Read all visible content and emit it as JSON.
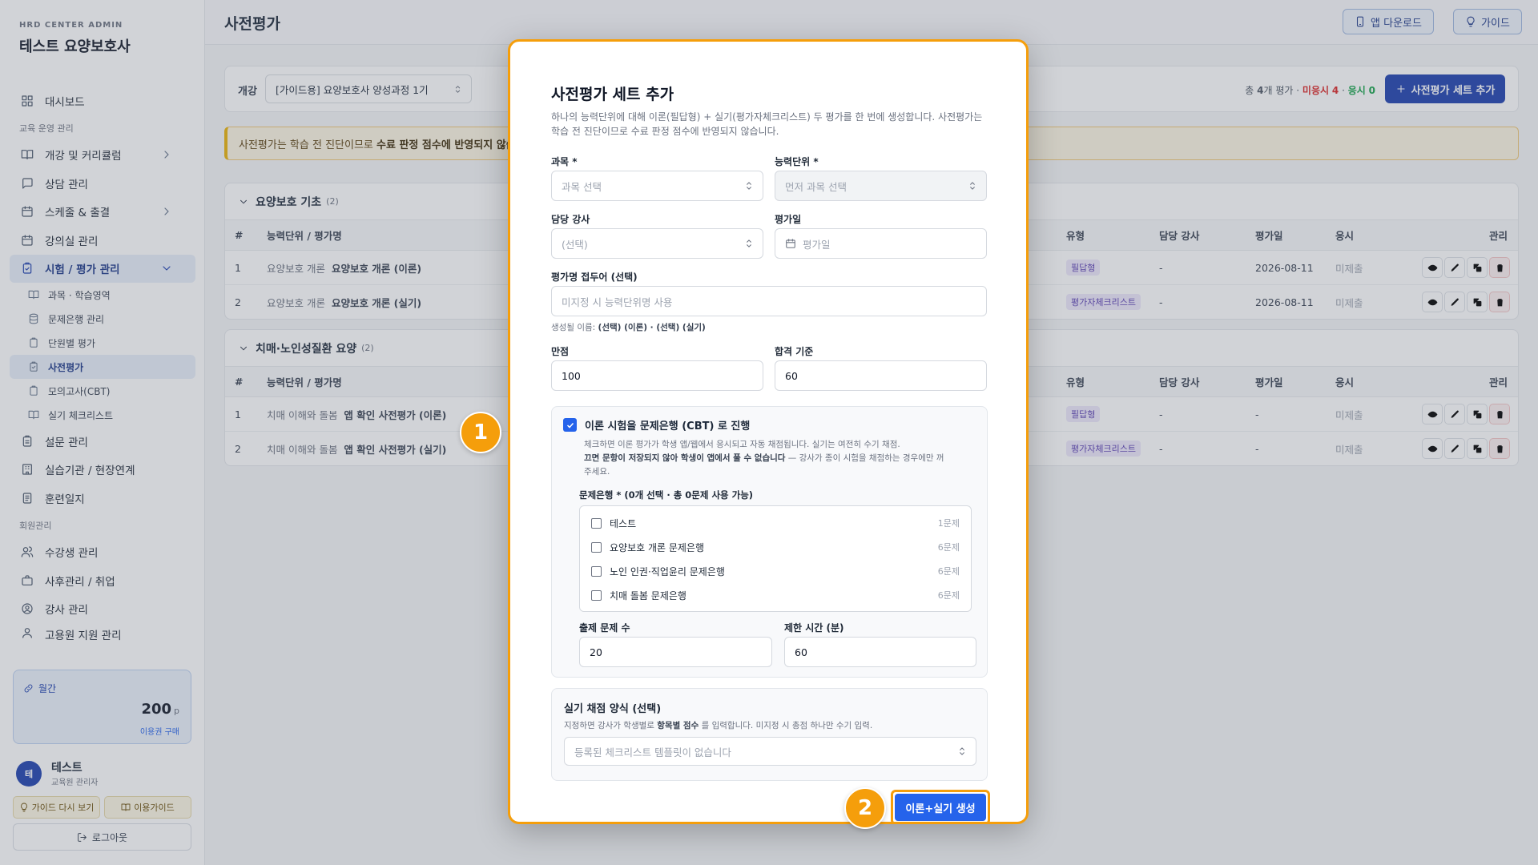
{
  "sidebar": {
    "brand_small": "HRD CENTER ADMIN",
    "brand": "테스트 요양보호사",
    "dashboard": "대시보드",
    "sec_edu": "교육 운영 관리",
    "items": [
      "개강 및 커리큘럼",
      "상담 관리",
      "스케줄 & 출결",
      "강의실 관리",
      "시험 / 평가 관리"
    ],
    "subs": [
      "과목 · 학습영역",
      "문제은행 관리",
      "단원별 평가",
      "사전평가",
      "모의고사(CBT)",
      "실기 체크리스트"
    ],
    "items2": [
      "설문 관리",
      "실습기관 / 현장연계",
      "훈련일지"
    ],
    "sec_member": "회원관리",
    "items3": [
      "수강생 관리",
      "사후관리 / 취업",
      "강사 관리",
      "고용원 지원 관리"
    ],
    "credit": {
      "label": "월간",
      "value": "200",
      "unit": "p",
      "buy": "이용권 구매"
    },
    "user": {
      "avatar": "테",
      "name": "테스트",
      "role": "교육원 관리자"
    },
    "guide_again": "가이드 다시 보기",
    "usage_guide": "이용가이드",
    "logout": "로그아웃"
  },
  "topbar": {
    "title": "사전평가",
    "app_download": "앱 다운로드",
    "guide": "가이드"
  },
  "filter": {
    "label": "개강",
    "course": "[가이드용] 요양보호사 양성과정 1기",
    "stats_pre": "총",
    "total": "4",
    "stats_mid": "개 평가 ·",
    "pending_label": "미응시",
    "pending": "4",
    "sep": "·",
    "done_label": "응시",
    "done": "0",
    "add_button": "사전평가 세트 추가"
  },
  "notice": {
    "text": "사전평가는 학습 전 진단이므로",
    "bold": "수료 판정 점수에 반영되지 않습"
  },
  "columns": {
    "num": "#",
    "name": "능력단위 / 평가명",
    "type": "유형",
    "teacher": "담당 강사",
    "date": "평가일",
    "status": "응시",
    "manage": "관리"
  },
  "groups": [
    {
      "title": "요양보호 기초",
      "count": "(2)",
      "rows": [
        {
          "num": "1",
          "unit": "요양보호 개론",
          "name": "요양보호 개론 (이론)",
          "type": "필답형",
          "teacher": "-",
          "date": "2026-08-11",
          "status": "미제출"
        },
        {
          "num": "2",
          "unit": "요양보호 개론",
          "name": "요양보호 개론 (실기)",
          "type": "평가자체크리스트",
          "teacher": "-",
          "date": "2026-08-11",
          "status": "미제출"
        }
      ]
    },
    {
      "title": "치매·노인성질환 요양",
      "count": "(2)",
      "rows": [
        {
          "num": "1",
          "unit": "치매 이해와 돌봄",
          "name": "앱 확인 사전평가 (이론)",
          "type": "필답형",
          "teacher": "-",
          "date": "-",
          "status": "미제출"
        },
        {
          "num": "2",
          "unit": "치매 이해와 돌봄",
          "name": "앱 확인 사전평가 (실기)",
          "type": "평가자체크리스트",
          "teacher": "-",
          "date": "-",
          "status": "미제출"
        }
      ]
    }
  ],
  "modal": {
    "title": "사전평가 세트 추가",
    "desc": "하나의 능력단위에 대해 이론(필답형) + 실기(평가자체크리스트) 두 평가를 한 번에 생성합니다. 사전평가는 학습 전 진단이므로 수료 판정 점수에 반영되지 않습니다.",
    "subject_label": "과목 *",
    "subject_ph": "과목 선택",
    "unit_label": "능력단위 *",
    "unit_ph": "먼저 과목 선택",
    "teacher_label": "담당 강사",
    "teacher_ph": "(선택)",
    "date_label": "평가일",
    "date_ph": "평가일",
    "prefix_label": "평가명 접두어 (선택)",
    "prefix_ph": "미지정 시 능력단위명 사용",
    "gen_name_pre": "생성될 이름:",
    "gen_name": "(선택) (이론) · (선택) (실기)",
    "full_label": "만점",
    "full_value": "100",
    "pass_label": "합격 기준",
    "pass_value": "60",
    "cbt": {
      "title": "이론 시험을 문제은행 (CBT) 로 진행",
      "desc1": "체크하면 이론 평가가 학생 앱/웹에서 응시되고 자동 채점됩니다. 실기는 여전히 수기 채점.",
      "desc2_bold": "끄면 문항이 저장되지 않아 학생이 앱에서 풀 수 없습니다",
      "desc2_rest": " — 강사가 종이 시험을 채점하는 경우에만 꺼",
      "desc3": "주세요.",
      "bank_label": "문제은행 * (0개 선택 · 총 0문제 사용 가능)",
      "banks": [
        {
          "name": "테스트",
          "count": "1문제"
        },
        {
          "name": "요양보호 개론 문제은행",
          "count": "6문제"
        },
        {
          "name": "노인 인권·직업윤리 문제은행",
          "count": "6문제"
        },
        {
          "name": "치매 돌봄 문제은행",
          "count": "6문제"
        }
      ],
      "qcount_label": "출제 문제 수",
      "qcount": "20",
      "time_label": "제한 시간 (분)",
      "time": "60"
    },
    "prac": {
      "title": "실기 채점 양식 (선택)",
      "desc_pre": "지정하면 강사가 학생별로",
      "desc_bold": "항목별 점수",
      "desc_post": "를 입력합니다. 미지정 시 총점 하나만 수기 입력.",
      "select_ph": "등록된 체크리스트 템플릿이 없습니다"
    },
    "generate": "이론+실기 생성"
  },
  "steps": [
    "1",
    "2"
  ],
  "colors": {
    "accent": "#1e40af",
    "highlight": "#f59e0b",
    "primary_button": "#2563eb"
  }
}
